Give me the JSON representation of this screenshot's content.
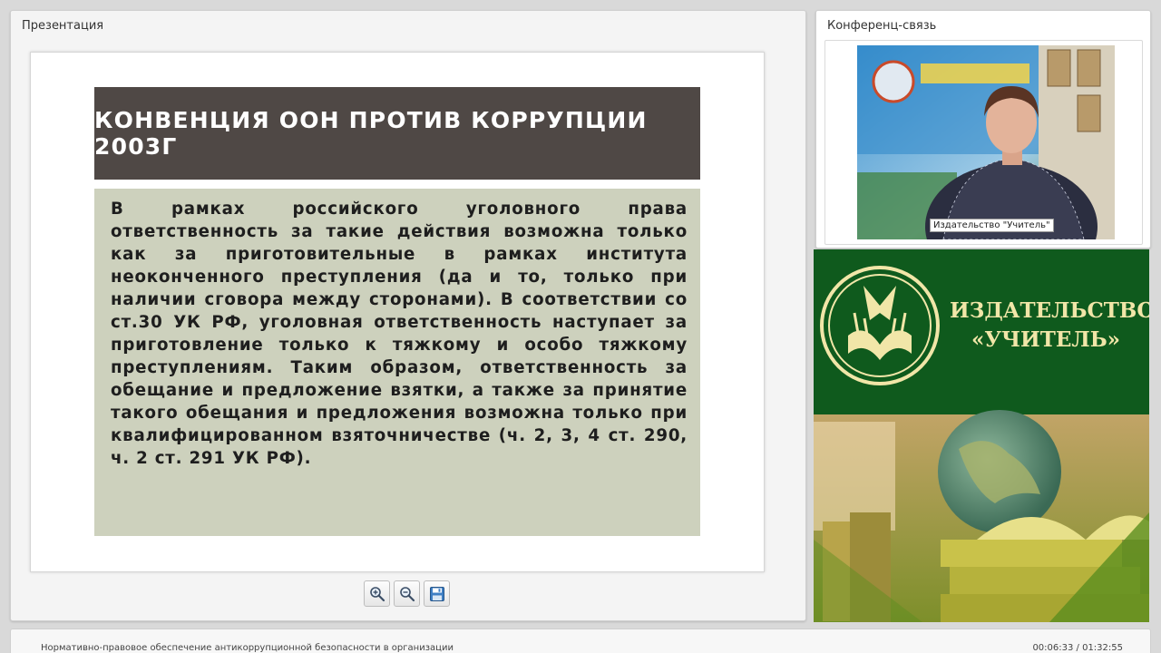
{
  "presentation": {
    "title": "Презентация",
    "slide": {
      "heading": "КОНВЕНЦИЯ ООН ПРОТИВ КОРРУПЦИИ 2003Г",
      "body": "В рамках российского уголовного права ответственность за такие действия возможна только как за приготовительные в рамках института неоконченного преступления (да и то, только при наличии сговора между сторонами). В соответствии со ст.30 УК РФ, уголовная ответственность наступает за приготовление только к тяжкому и особо тяжкому преступлениям. Таким образом, ответственность за обещание и предложение взятки, а также за принятие такого обещания и предложения возможна только при квалифицированном взяточничестве (ч. 2, 3, 4 ст. 290, ч. 2 ст. 291 УК РФ)."
    },
    "toolbar": {
      "zoom_in_icon": "zoom-in-icon",
      "zoom_out_icon": "zoom-out-icon",
      "save_icon": "floppy-disk-icon"
    }
  },
  "conference": {
    "title": "Конференц-связь",
    "caption": "Издательство \"Учитель\""
  },
  "banner": {
    "line1": "ИЗДАТЕЛЬСТВО",
    "line2": "«УЧИТЕЛЬ»"
  },
  "status": {
    "course_title": "Нормативно-правовое обеспечение антикоррупционной безопасности в организации",
    "time": "00:06:33 / 01:32:55"
  },
  "colors": {
    "slide_heading_bg": "#4f4845",
    "slide_body_bg": "#cdd1bd",
    "banner_green": "#0f5a1d",
    "banner_gold": "#f1e6a8"
  }
}
